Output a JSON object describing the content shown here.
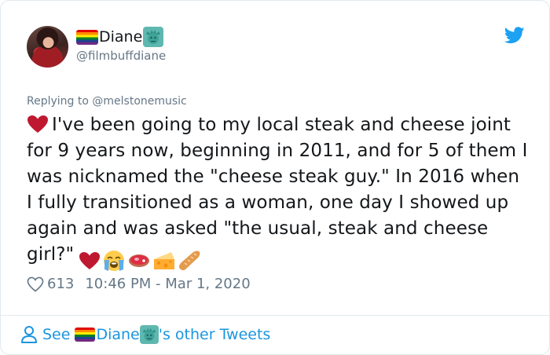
{
  "user": {
    "display_name": "Diane",
    "handle": "@filmbuffdiane"
  },
  "reply": {
    "prefix": "Replying to",
    "to_handle": "@melstonemusic"
  },
  "tweet": {
    "text": "I've been going to my local steak and cheese joint for 9 years now, beginning in 2011, and for 5 of them I was nicknamed the \"cheese steak guy.\" In 2016 when I fully transitioned as a woman, one day I showed up again and was asked \"the usual, steak and cheese girl?\"",
    "emojis": [
      "red-heart",
      "loudly-crying-face",
      "cut-of-meat",
      "cheese-wedge",
      "baguette-bread"
    ]
  },
  "meta": {
    "likes": "613",
    "timestamp": "10:46 PM - Mar 1, 2020"
  },
  "footer": {
    "see_label": "See",
    "name": "Diane",
    "suffix": "'s other Tweets"
  },
  "colors": {
    "link_blue": "#1b95e0",
    "secondary_gray": "#657786",
    "twitter_blue": "#1da1f2",
    "heart_red": "#be1931"
  }
}
